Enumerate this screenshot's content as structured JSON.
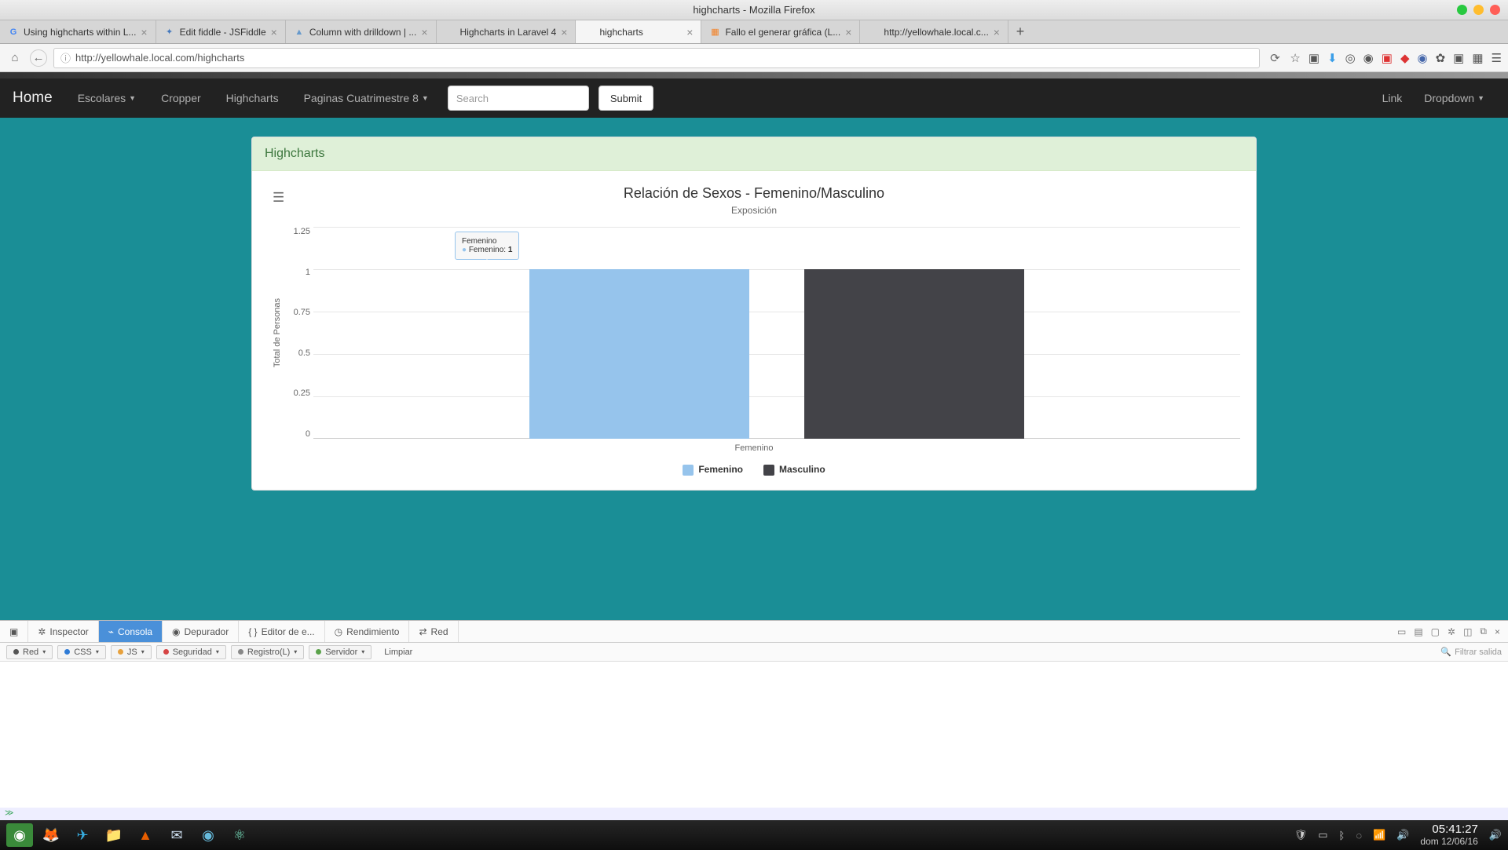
{
  "window": {
    "title": "highcharts - Mozilla Firefox"
  },
  "tabs": [
    {
      "label": "Using highcharts within L...",
      "icon": "G"
    },
    {
      "label": "Edit fiddle - JSFiddle",
      "icon": "✦"
    },
    {
      "label": "Column with drilldown | ...",
      "icon": "▲"
    },
    {
      "label": "Highcharts in Laravel 4",
      "icon": " "
    },
    {
      "label": "highcharts",
      "icon": " ",
      "active": true
    },
    {
      "label": "Fallo el generar gráfica (L...",
      "icon": "▦"
    },
    {
      "label": "http://yellowhale.local.c...",
      "icon": " "
    }
  ],
  "url": "http://yellowhale.local.com/highcharts",
  "nav": {
    "brand": "Home",
    "links": [
      "Escolares",
      "Cropper",
      "Highcharts",
      "Paginas Cuatrimestre 8"
    ],
    "search_placeholder": "Search",
    "submit": "Submit",
    "right": [
      "Link",
      "Dropdown"
    ]
  },
  "panel": {
    "title": "Highcharts"
  },
  "chart_data": {
    "type": "bar",
    "title": "Relación de Sexos - Femenino/Masculino",
    "subtitle": "Exposición",
    "ylabel": "Total de Personas",
    "xlabel": "Femenino",
    "ymax": 1.25,
    "yticks": [
      "1.25",
      "1",
      "0.75",
      "0.5",
      "0.25",
      "0"
    ],
    "categories": [
      "Femenino"
    ],
    "series": [
      {
        "name": "Femenino",
        "color": "#96c4ec",
        "values": [
          1
        ]
      },
      {
        "name": "Masculino",
        "color": "#434348",
        "values": [
          1
        ]
      }
    ],
    "tooltip": {
      "header": "Femenino",
      "label": "Femenino",
      "value": "1"
    }
  },
  "devtools": {
    "tabs": [
      "Inspector",
      "Consola",
      "Depurador",
      "Editor de e...",
      "Rendimiento",
      "Red"
    ],
    "active": 1,
    "filters": [
      {
        "label": "Red",
        "color": "#555"
      },
      {
        "label": "CSS",
        "color": "#2e7bd6"
      },
      {
        "label": "JS",
        "color": "#e7a13d"
      },
      {
        "label": "Seguridad",
        "color": "#d64545"
      },
      {
        "label": "Registro(L)",
        "color": "#888"
      },
      {
        "label": "Servidor",
        "color": "#5aa24a"
      }
    ],
    "clear": "Limpiar",
    "filter_placeholder": "Filtrar salida"
  },
  "systray": {
    "time": "05:41:27",
    "date": "dom 12/06/16"
  }
}
